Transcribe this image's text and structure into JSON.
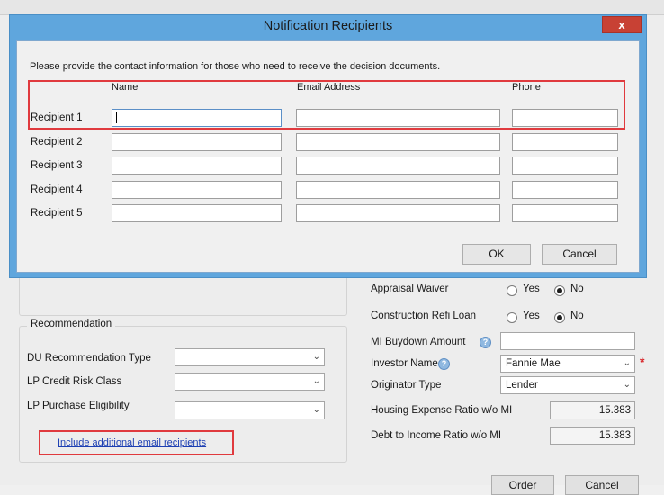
{
  "dialog": {
    "title": "Notification Recipients",
    "close_glyph": "x",
    "instructions": "Please provide the contact information for those who need to receive the decision documents.",
    "columns": {
      "name": "Name",
      "email": "Email Address",
      "phone": "Phone"
    },
    "recipients": [
      {
        "label": "Recipient 1",
        "name": "",
        "email": "",
        "phone": ""
      },
      {
        "label": "Recipient 2",
        "name": "",
        "email": "",
        "phone": ""
      },
      {
        "label": "Recipient 3",
        "name": "",
        "email": "",
        "phone": ""
      },
      {
        "label": "Recipient 4",
        "name": "",
        "email": "",
        "phone": ""
      },
      {
        "label": "Recipient 5",
        "name": "",
        "email": "",
        "phone": ""
      }
    ],
    "ok_label": "OK",
    "cancel_label": "Cancel"
  },
  "background": {
    "recommendation": {
      "title": "Recommendation",
      "du_type_label": "DU Recommendation Type",
      "lp_risk_label": "LP Credit Risk Class",
      "lp_eligibility_label": "LP Purchase Eligibility",
      "du_type_value": "",
      "lp_risk_value": "",
      "lp_eligibility_value": ""
    },
    "include_link": "Include additional email recipients",
    "appraisal_waiver": {
      "label": "Appraisal Waiver",
      "yes": "Yes",
      "no": "No",
      "selected": "No"
    },
    "construction_refi": {
      "label": "Construction Refi Loan",
      "yes": "Yes",
      "no": "No",
      "selected": "No"
    },
    "mi_buydown_label": "MI Buydown Amount",
    "mi_buydown_value": "",
    "investor_label": "Investor Name",
    "investor_value": "Fannie Mae",
    "originator_label": "Originator Type",
    "originator_value": "Lender",
    "housing_ratio_label": "Housing Expense Ratio w/o MI",
    "housing_ratio_value": "15.383",
    "dti_label": "Debt to Income Ratio w/o MI",
    "dti_value": "15.383",
    "order_label": "Order",
    "cancel_label": "Cancel"
  },
  "colors": {
    "dialog_frame": "#5fa6dd",
    "highlight": "#e03a3e",
    "link": "#1c3fb3",
    "close": "#c84134"
  }
}
